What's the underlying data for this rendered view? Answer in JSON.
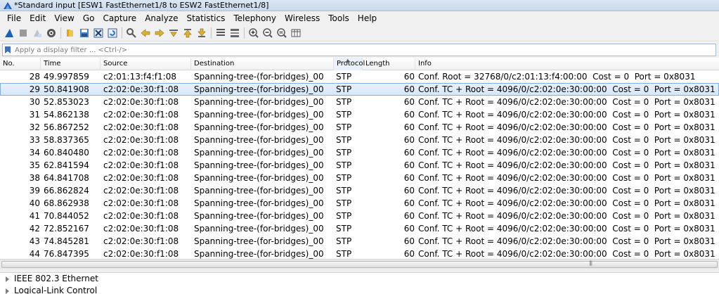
{
  "window": {
    "title": "*Standard input [ESW1 FastEthernet1/8 to ESW2 FastEthernet1/8]"
  },
  "menu": [
    "File",
    "Edit",
    "View",
    "Go",
    "Capture",
    "Analyze",
    "Statistics",
    "Telephony",
    "Wireless",
    "Tools",
    "Help"
  ],
  "toolbar_icons": [
    "shark-fin-start-icon",
    "stop-square-icon",
    "restart-icon",
    "options-gear-icon",
    "open-folder-icon",
    "save-file-icon",
    "close-file-icon",
    "reload-file-icon",
    "find-packet-icon",
    "go-back-icon",
    "go-forward-icon",
    "go-to-packet-icon",
    "first-packet-icon",
    "last-packet-icon",
    "autoscroll-icon",
    "colorize-icon",
    "zoom-in-icon",
    "zoom-out-icon",
    "normal-size-icon",
    "resize-columns-icon"
  ],
  "filter": {
    "placeholder": "Apply a display filter ... <Ctrl-/>"
  },
  "columns": {
    "no": "No.",
    "time": "Time",
    "source": "Source",
    "destination": "Destination",
    "protocol": "Protocol",
    "length": "Length",
    "info": "Info"
  },
  "packets": [
    {
      "no": "28",
      "time": "49.997859",
      "source": "c2:01:13:f4:f1:08",
      "destination": "Spanning-tree-(for-bridges)_00",
      "protocol": "STP",
      "length": "60",
      "info": "Conf. Root = 32768/0/c2:01:13:f4:00:00  Cost = 0  Port = 0x8031",
      "selected": false
    },
    {
      "no": "29",
      "time": "50.841908",
      "source": "c2:02:0e:30:f1:08",
      "destination": "Spanning-tree-(for-bridges)_00",
      "protocol": "STP",
      "length": "60",
      "info": "Conf. TC + Root = 4096/0/c2:02:0e:30:00:00  Cost = 0  Port = 0x8031",
      "selected": true
    },
    {
      "no": "30",
      "time": "52.853023",
      "source": "c2:02:0e:30:f1:08",
      "destination": "Spanning-tree-(for-bridges)_00",
      "protocol": "STP",
      "length": "60",
      "info": "Conf. TC + Root = 4096/0/c2:02:0e:30:00:00  Cost = 0  Port = 0x8031",
      "selected": false
    },
    {
      "no": "31",
      "time": "54.862138",
      "source": "c2:02:0e:30:f1:08",
      "destination": "Spanning-tree-(for-bridges)_00",
      "protocol": "STP",
      "length": "60",
      "info": "Conf. TC + Root = 4096/0/c2:02:0e:30:00:00  Cost = 0  Port = 0x8031",
      "selected": false
    },
    {
      "no": "32",
      "time": "56.867252",
      "source": "c2:02:0e:30:f1:08",
      "destination": "Spanning-tree-(for-bridges)_00",
      "protocol": "STP",
      "length": "60",
      "info": "Conf. TC + Root = 4096/0/c2:02:0e:30:00:00  Cost = 0  Port = 0x8031",
      "selected": false
    },
    {
      "no": "33",
      "time": "58.837365",
      "source": "c2:02:0e:30:f1:08",
      "destination": "Spanning-tree-(for-bridges)_00",
      "protocol": "STP",
      "length": "60",
      "info": "Conf. TC + Root = 4096/0/c2:02:0e:30:00:00  Cost = 0  Port = 0x8031",
      "selected": false
    },
    {
      "no": "34",
      "time": "60.840480",
      "source": "c2:02:0e:30:f1:08",
      "destination": "Spanning-tree-(for-bridges)_00",
      "protocol": "STP",
      "length": "60",
      "info": "Conf. TC + Root = 4096/0/c2:02:0e:30:00:00  Cost = 0  Port = 0x8031",
      "selected": false
    },
    {
      "no": "35",
      "time": "62.841594",
      "source": "c2:02:0e:30:f1:08",
      "destination": "Spanning-tree-(for-bridges)_00",
      "protocol": "STP",
      "length": "60",
      "info": "Conf. TC + Root = 4096/0/c2:02:0e:30:00:00  Cost = 0  Port = 0x8031",
      "selected": false
    },
    {
      "no": "38",
      "time": "64.841708",
      "source": "c2:02:0e:30:f1:08",
      "destination": "Spanning-tree-(for-bridges)_00",
      "protocol": "STP",
      "length": "60",
      "info": "Conf. TC + Root = 4096/0/c2:02:0e:30:00:00  Cost = 0  Port = 0x8031",
      "selected": false
    },
    {
      "no": "39",
      "time": "66.862824",
      "source": "c2:02:0e:30:f1:08",
      "destination": "Spanning-tree-(for-bridges)_00",
      "protocol": "STP",
      "length": "60",
      "info": "Conf. TC + Root = 4096/0/c2:02:0e:30:00:00  Cost = 0  Port = 0x8031",
      "selected": false
    },
    {
      "no": "40",
      "time": "68.862938",
      "source": "c2:02:0e:30:f1:08",
      "destination": "Spanning-tree-(for-bridges)_00",
      "protocol": "STP",
      "length": "60",
      "info": "Conf. TC + Root = 4096/0/c2:02:0e:30:00:00  Cost = 0  Port = 0x8031",
      "selected": false
    },
    {
      "no": "41",
      "time": "70.844052",
      "source": "c2:02:0e:30:f1:08",
      "destination": "Spanning-tree-(for-bridges)_00",
      "protocol": "STP",
      "length": "60",
      "info": "Conf. TC + Root = 4096/0/c2:02:0e:30:00:00  Cost = 0  Port = 0x8031",
      "selected": false
    },
    {
      "no": "42",
      "time": "72.852167",
      "source": "c2:02:0e:30:f1:08",
      "destination": "Spanning-tree-(for-bridges)_00",
      "protocol": "STP",
      "length": "60",
      "info": "Conf. TC + Root = 4096/0/c2:02:0e:30:00:00  Cost = 0  Port = 0x8031",
      "selected": false
    },
    {
      "no": "43",
      "time": "74.845281",
      "source": "c2:02:0e:30:f1:08",
      "destination": "Spanning-tree-(for-bridges)_00",
      "protocol": "STP",
      "length": "60",
      "info": "Conf. TC + Root = 4096/0/c2:02:0e:30:00:00  Cost = 0  Port = 0x8031",
      "selected": false
    },
    {
      "no": "44",
      "time": "76.847395",
      "source": "c2:02:0e:30:f1:08",
      "destination": "Spanning-tree-(for-bridges)_00",
      "protocol": "STP",
      "length": "60",
      "info": "Conf. TC + Root = 4096/0/c2:02:0e:30:00:00  Cost = 0  Port = 0x8031",
      "selected": false
    }
  ],
  "details": [
    "IEEE 802.3 Ethernet",
    "Logical-Link Control"
  ],
  "colors": {
    "selected_row": "#d6e7f9",
    "selected_outline": "#84acdd",
    "accent": "#1e5bb0"
  }
}
